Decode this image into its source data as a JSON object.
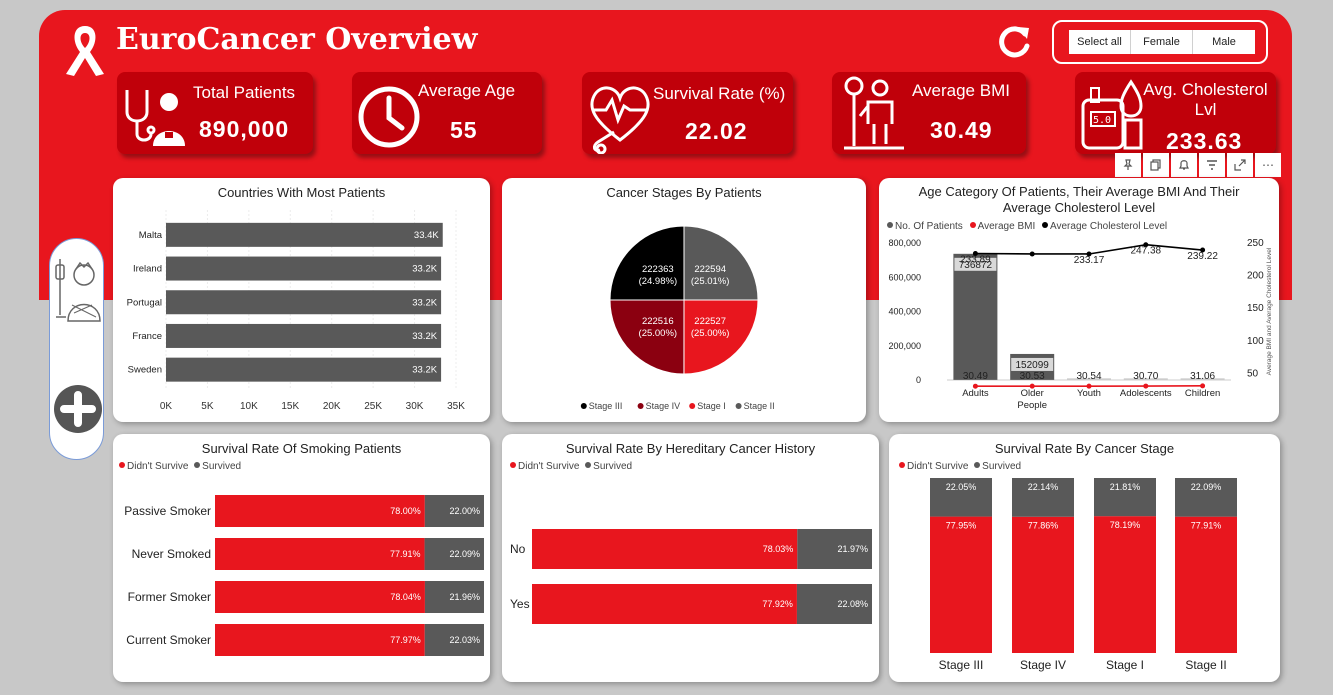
{
  "title": "EuroCancer Overview",
  "slicer": {
    "options": [
      "Select all",
      "Female",
      "Male"
    ]
  },
  "kpis": {
    "total_patients": {
      "label": "Total Patients",
      "value": "890,000"
    },
    "average_age": {
      "label": "Average Age",
      "value": "55"
    },
    "survival_rate": {
      "label": "Survival Rate (%)",
      "value": "22.02"
    },
    "average_bmi": {
      "label": "Average BMI",
      "value": "30.49"
    },
    "avg_cholesterol": {
      "label": "Avg. Cholesterol Lvl",
      "value": "233.63"
    }
  },
  "colors": {
    "accent": "#e8161e",
    "dark_red": "#c0000a",
    "gray": "#595959",
    "black": "#000000",
    "maroon": "#8b0010"
  },
  "charts": {
    "countries": {
      "title": "Countries With Most Patients",
      "chart_data": {
        "type": "bar",
        "categories": [
          "Malta",
          "Ireland",
          "Portugal",
          "France",
          "Sweden"
        ],
        "values": [
          33.4,
          33.2,
          33.2,
          33.2,
          33.2
        ],
        "labels": [
          "33.4K",
          "33.2K",
          "33.2K",
          "33.2K",
          "33.2K"
        ],
        "xticks": [
          "0K",
          "5K",
          "10K",
          "15K",
          "20K",
          "25K",
          "30K",
          "35K"
        ],
        "xlim": [
          0,
          35
        ]
      }
    },
    "stages": {
      "title": "Cancer Stages By Patients",
      "chart_data": {
        "type": "pie",
        "slices": [
          {
            "name": "Stage II",
            "value": 222594,
            "pct": "(25.01%)",
            "color": "#595959"
          },
          {
            "name": "Stage I",
            "value": 222527,
            "pct": "(25.00%)",
            "color": "#e8161e"
          },
          {
            "name": "Stage IV",
            "value": 222516,
            "pct": "(25.00%)",
            "color": "#8b0010"
          },
          {
            "name": "Stage III",
            "value": 222363,
            "pct": "(24.98%)",
            "color": "#000000"
          }
        ],
        "legend": [
          "Stage III",
          "Stage IV",
          "Stage I",
          "Stage II"
        ]
      }
    },
    "age": {
      "title_line1": "Age Category Of Patients, Their Average BMI And Their",
      "title_line2": "Average Cholesterol Level",
      "legend": [
        "No. Of Patients",
        "Average BMI",
        "Average Cholesterol Level"
      ],
      "chart_data": {
        "type": "bar",
        "categories": [
          "Adults",
          "Older People",
          "Youth",
          "Adolescents",
          "Children"
        ],
        "category_lines": [
          [
            "Adults"
          ],
          [
            "Older",
            "People"
          ],
          [
            "Youth"
          ],
          [
            "Adolescents"
          ],
          [
            "Children"
          ]
        ],
        "series": [
          {
            "name": "No. Of Patients",
            "values": [
              736872,
              152099,
              0,
              0,
              0
            ],
            "labels": [
              "736872",
              "152099",
              "",
              "",
              ""
            ]
          },
          {
            "name": "Average BMI",
            "values": [
              30.49,
              30.53,
              30.54,
              30.7,
              31.06
            ],
            "labels": [
              "30.49",
              "30.53",
              "30.54",
              "30.70",
              "31.06"
            ]
          },
          {
            "name": "Average Cholesterol Level",
            "values": [
              233.89,
              233.17,
              233.17,
              247.38,
              239.22
            ],
            "labels": [
              "233.89",
              "",
              "233.17",
              "247.38",
              "239.22"
            ]
          }
        ],
        "yticks_left": [
          "800,000",
          "600,000",
          "400,000",
          "200,000",
          "0"
        ],
        "yticks_right": [
          "250",
          "200",
          "150",
          "100",
          "50"
        ],
        "ylim_left": [
          0,
          800000
        ],
        "ylim_right": [
          40,
          250
        ],
        "y2label": "Average BMI and Average Cholesterol Level"
      }
    },
    "smoking": {
      "title": "Survival Rate Of Smoking Patients",
      "legend": [
        "Didn't Survive",
        "Survived"
      ],
      "chart_data": {
        "type": "bar",
        "categories": [
          "Passive Smoker",
          "Never Smoked",
          "Former Smoker",
          "Current Smoker"
        ],
        "series": [
          {
            "name": "Didn't Survive",
            "values": [
              78.0,
              77.91,
              78.04,
              77.97
            ],
            "labels": [
              "78.00%",
              "77.91%",
              "78.04%",
              "77.97%"
            ]
          },
          {
            "name": "Survived",
            "values": [
              22.0,
              22.09,
              21.96,
              22.03
            ],
            "labels": [
              "22.00%",
              "22.09%",
              "21.96%",
              "22.03%"
            ]
          }
        ]
      }
    },
    "hereditary": {
      "title": "Survival Rate By Hereditary Cancer History",
      "legend": [
        "Didn't Survive",
        "Survived"
      ],
      "chart_data": {
        "type": "bar",
        "categories": [
          "No",
          "Yes"
        ],
        "series": [
          {
            "name": "Didn't Survive",
            "values": [
              78.03,
              77.92
            ],
            "labels": [
              "78.03%",
              "77.92%"
            ]
          },
          {
            "name": "Survived",
            "values": [
              21.97,
              22.08
            ],
            "labels": [
              "21.97%",
              "22.08%"
            ]
          }
        ]
      }
    },
    "stage_survival": {
      "title": "Survival Rate By Cancer Stage",
      "legend": [
        "Didn't Survive",
        "Survived"
      ],
      "chart_data": {
        "type": "bar",
        "categories": [
          "Stage III",
          "Stage IV",
          "Stage I",
          "Stage II"
        ],
        "series": [
          {
            "name": "Didn't Survive",
            "values": [
              77.95,
              77.86,
              78.19,
              77.91
            ],
            "labels": [
              "77.95%",
              "77.86%",
              "78.19%",
              "77.91%"
            ]
          },
          {
            "name": "Survived",
            "values": [
              22.05,
              22.14,
              21.81,
              22.09
            ],
            "labels": [
              "22.05%",
              "22.14%",
              "21.81%",
              "22.09%"
            ]
          }
        ]
      }
    }
  },
  "toolbar": {
    "icons": [
      "pin-icon",
      "copy-icon",
      "bell-icon",
      "filter-icon",
      "expand-icon",
      "more-icon"
    ],
    "more_label": "⋯"
  }
}
